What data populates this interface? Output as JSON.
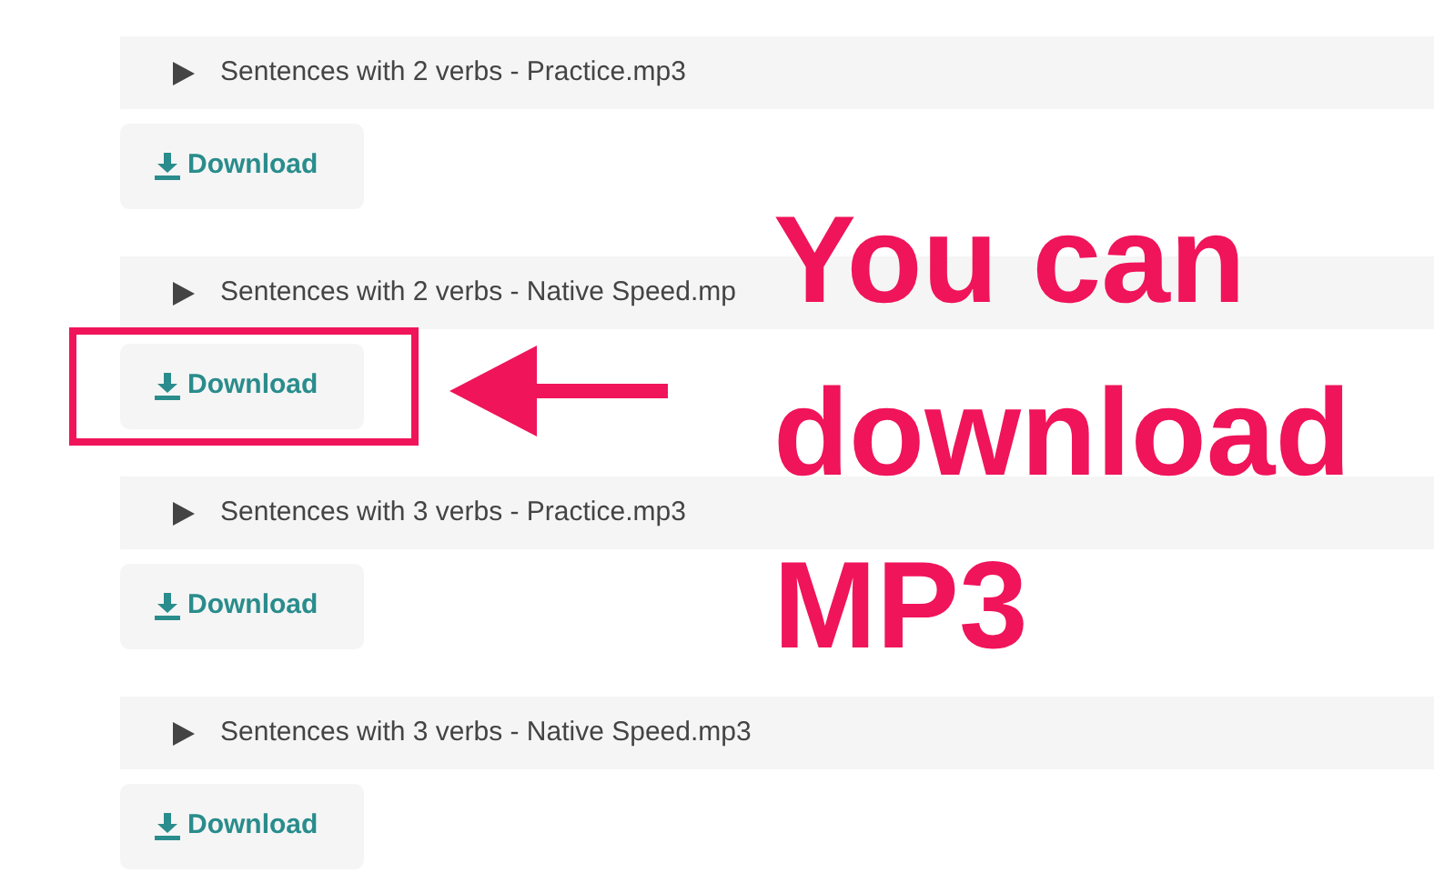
{
  "tracks": [
    {
      "title": "Sentences with 2 verbs - Practice.mp3",
      "button": "Download",
      "highlighted": false
    },
    {
      "title": "Sentences with 2 verbs - Native Speed.mp",
      "button": "Download",
      "highlighted": true
    },
    {
      "title": "Sentences with 3 verbs - Practice.mp3",
      "button": "Download",
      "highlighted": false
    },
    {
      "title": "Sentences with 3 verbs - Native Speed.mp3",
      "button": "Download",
      "highlighted": false
    }
  ],
  "annotation": {
    "lines": [
      "You can",
      "download",
      "MP3"
    ]
  }
}
